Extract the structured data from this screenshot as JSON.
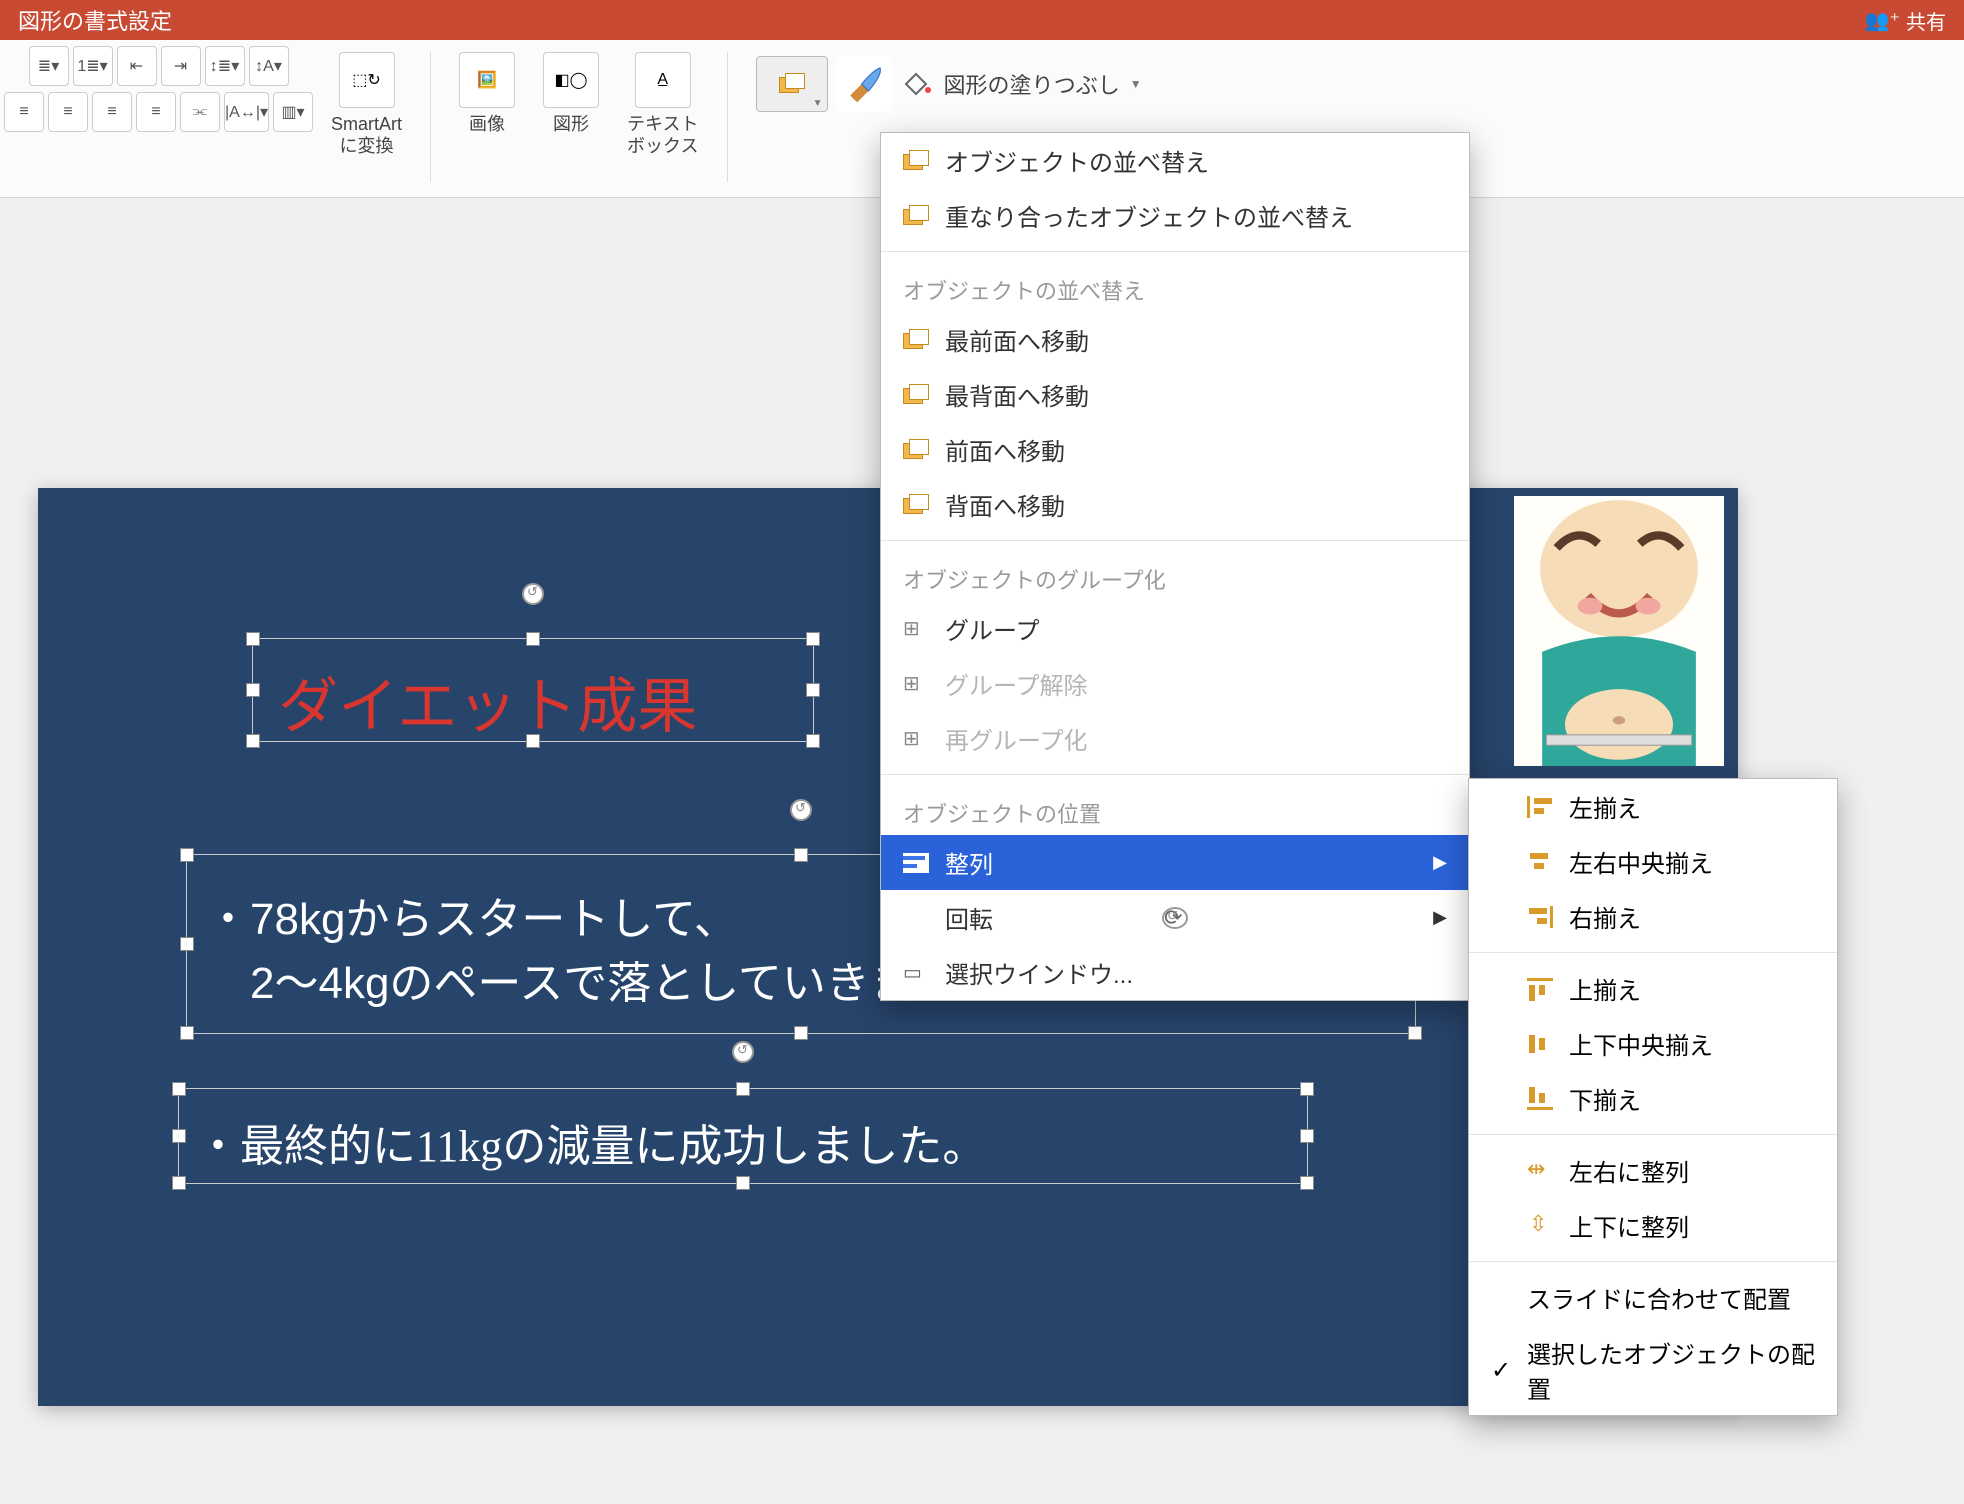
{
  "titlebar": {
    "title": "図形の書式設定",
    "share": "共有"
  },
  "ribbon": {
    "smartart_l1": "SmartArt",
    "smartart_l2": "に変換",
    "image": "画像",
    "shape": "図形",
    "textbox_l1": "テキスト",
    "textbox_l2": "ボックス",
    "fill": "図形の塗りつぶし"
  },
  "menu": {
    "reorder": "オブジェクトの並べ替え",
    "reorder_overlap": "重なり合ったオブジェクトの並べ替え",
    "hdr_order": "オブジェクトの並べ替え",
    "front": "最前面へ移動",
    "back": "最背面へ移動",
    "fwd": "前面へ移動",
    "bwd": "背面へ移動",
    "hdr_group": "オブジェクトのグループ化",
    "group": "グループ",
    "ungroup": "グループ解除",
    "regroup": "再グループ化",
    "hdr_pos": "オブジェクトの位置",
    "align": "整列",
    "rotate": "回転",
    "selpane": "選択ウインドウ..."
  },
  "submenu": {
    "left": "左揃え",
    "hcenter": "左右中央揃え",
    "right": "右揃え",
    "top": "上揃え",
    "vcenter": "上下中央揃え",
    "bottom": "下揃え",
    "disth": "左右に整列",
    "distv": "上下に整列",
    "toslide": "スライドに合わせて配置",
    "tosele": "選択したオブジェクトの配置"
  },
  "slide": {
    "title": "ダイエット成果",
    "body1_l1": "・78kgからスタートして、",
    "body1_l2": "　2〜4kgのペースで落としていきました。",
    "body2": "・最終的に11kgの減量に成功しました。"
  }
}
